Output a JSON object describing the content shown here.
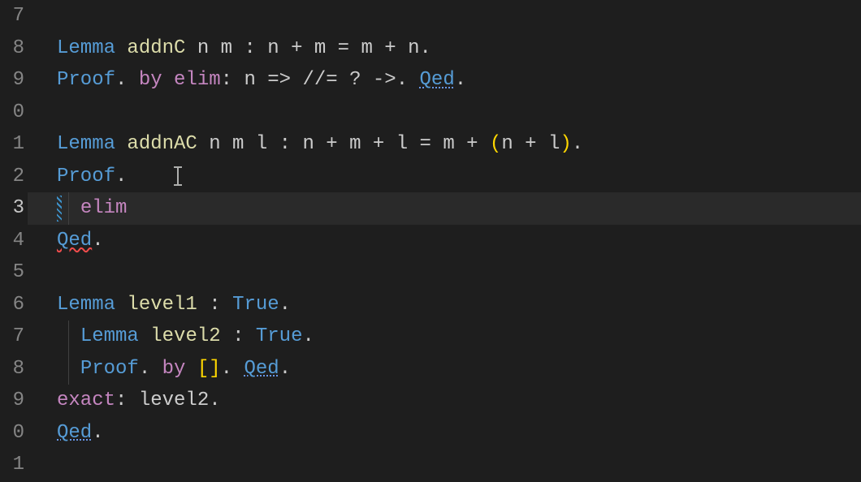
{
  "lineNumbers": [
    "7",
    "8",
    "9",
    "0",
    "1",
    "2",
    "3",
    "4",
    "5",
    "6",
    "7",
    "8",
    "9",
    "0",
    "1"
  ],
  "activeLineIndex": 6,
  "tokens": {
    "Lemma": "Lemma",
    "Proof": "Proof",
    "Qed": "Qed",
    "by": "by",
    "elim": "elim",
    "exact": "exact",
    "True": "True",
    "addnC": "addnC",
    "addnAC": "addnAC",
    "level1": "level1",
    "level2": "level2",
    "sig_nm": " n m ",
    "sig_nml": " n m l ",
    "colon": ": ",
    "dot": ".",
    "brackets": "[]",
    "rhs_addnC": "n + m = m + n",
    "rhs_addnAC_1": "n + m + l = m + ",
    "lp": "(",
    "rp": ")",
    "rhs_addnAC_2": "n + l",
    "elim_tac": ": n => //= ? ->",
    "exact_tac": ": level2",
    "sp": " ",
    "sp2": "  ",
    "sp4": "    "
  }
}
